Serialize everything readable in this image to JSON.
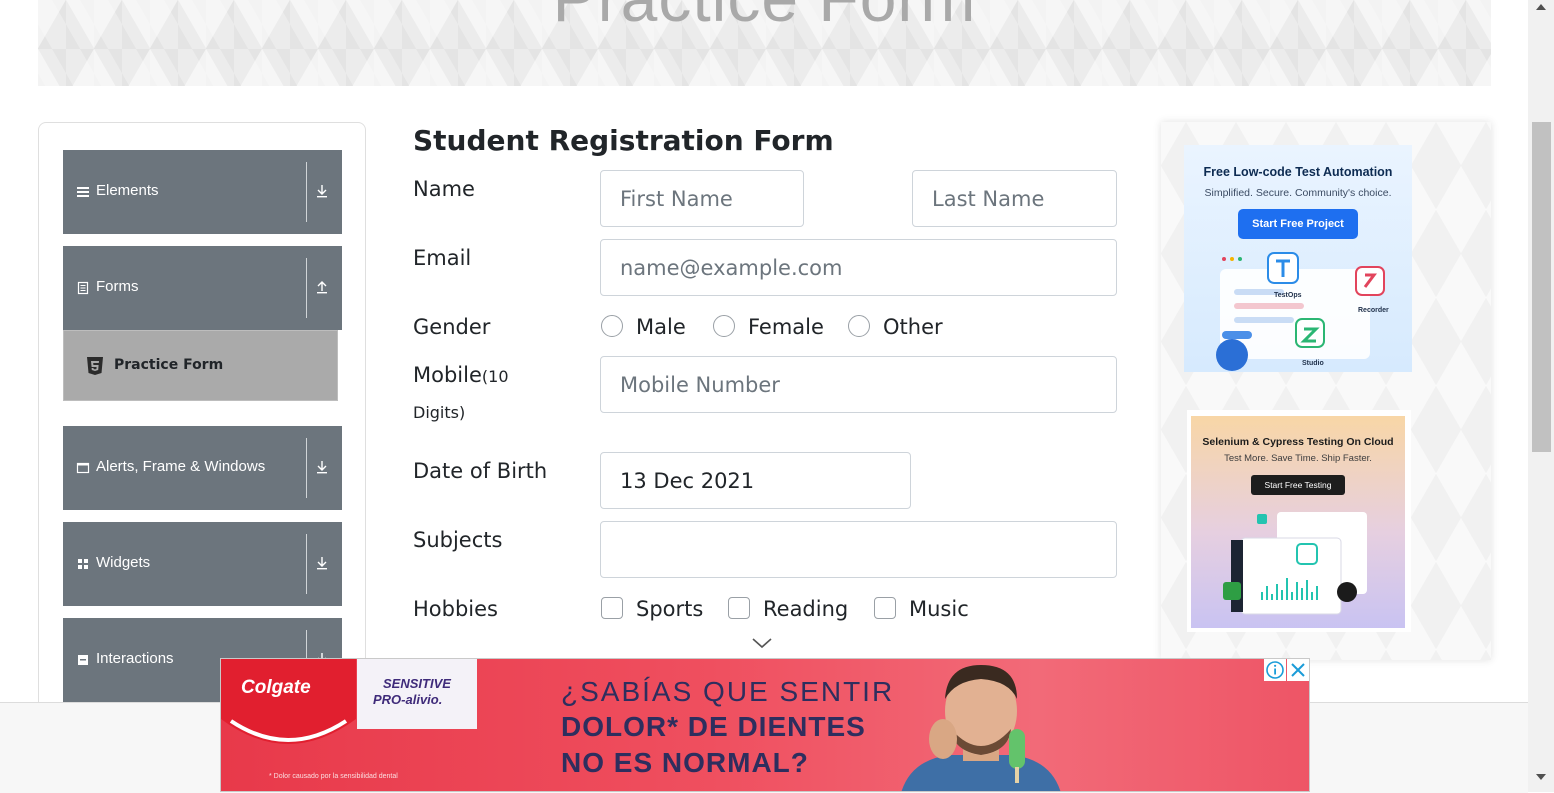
{
  "banner": {
    "title": "Practice Form"
  },
  "sidebar": {
    "groups": [
      {
        "label": "Elements",
        "icon": "hamburger-icon",
        "state": "collapsed"
      },
      {
        "label": "Forms",
        "icon": "document-icon",
        "state": "expanded"
      },
      {
        "label": "Alerts, Frame & Windows",
        "icon": "window-icon",
        "state": "collapsed"
      },
      {
        "label": "Widgets",
        "icon": "grid-icon",
        "state": "collapsed"
      },
      {
        "label": "Interactions",
        "icon": "box-icon",
        "state": "collapsed"
      }
    ],
    "active_item": {
      "label": "Practice Form",
      "icon": "html5-icon"
    }
  },
  "form": {
    "title": "Student Registration Form",
    "name_label": "Name",
    "first_name_placeholder": "First Name",
    "last_name_placeholder": "Last Name",
    "email_label": "Email",
    "email_placeholder": "name@example.com",
    "gender_label": "Gender",
    "gender_options": [
      "Male",
      "Female",
      "Other"
    ],
    "mobile_label": "Mobile",
    "mobile_hint_1": "(10",
    "mobile_hint_2": "Digits)",
    "mobile_placeholder": "Mobile Number",
    "dob_label": "Date of Birth",
    "dob_value": "13 Dec 2021",
    "subjects_label": "Subjects",
    "subjects_value": "",
    "hobbies_label": "Hobbies",
    "hobby_options": [
      "Sports",
      "Reading",
      "Music"
    ]
  },
  "ads": {
    "katalon": {
      "title": "Free Low-code Test Automation",
      "subtitle": "Simplified. Secure. Community's choice.",
      "button": "Start Free Project",
      "labels": [
        "TestOps",
        "Recorder",
        "Studio"
      ]
    },
    "lambdatest": {
      "title": "Selenium & Cypress Testing On Cloud",
      "subtitle": "Test More. Save Time. Ship Faster.",
      "button": "Start Free Testing"
    },
    "colgate": {
      "brand": "Colgate",
      "product_line1": "SENSITIVE",
      "product_line2": "PRO-alivio.",
      "headline1": "¿SABÍAS QUE SENTIR",
      "headline2": "DOLOR* DE DIENTES",
      "headline3": "NO ES NORMAL?",
      "footnote": "* Dolor causado por la sensibilidad dental"
    }
  },
  "colors": {
    "sidebar_group": "#6c757d",
    "active_item": "#aaaaaa",
    "ad_red": "#e8394a",
    "ad_navy": "#2e2e5e",
    "accent_blue": "#1e6ff0"
  }
}
